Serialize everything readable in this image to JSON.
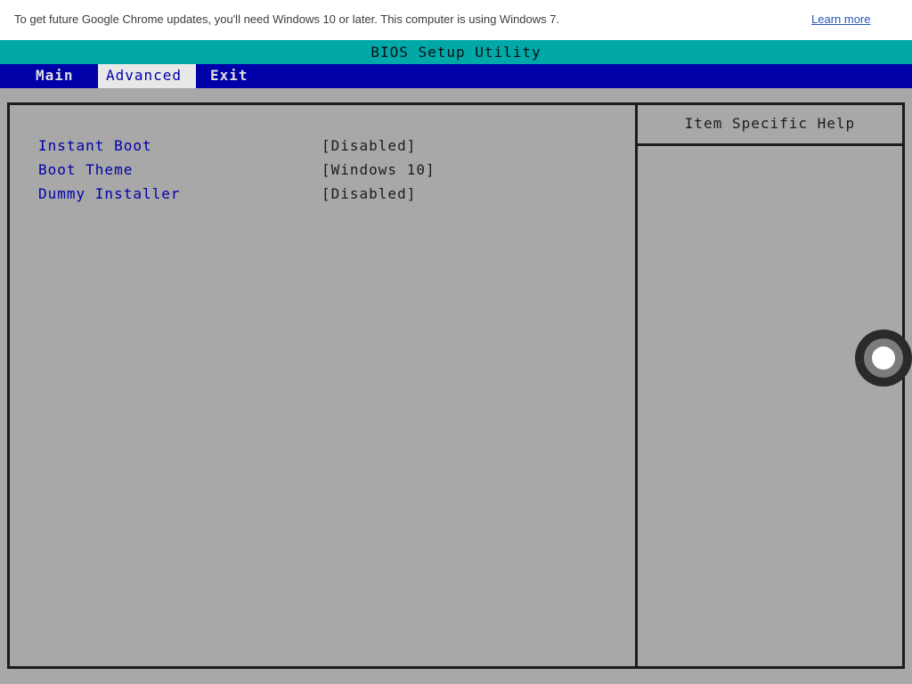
{
  "infobar": {
    "message": "To get future Google Chrome updates, you'll need Windows 10 or later. This computer is using Windows 7.",
    "learn_more": "Learn more"
  },
  "bios": {
    "title": "BIOS Setup Utility",
    "menu": [
      {
        "label": "Main",
        "active": false
      },
      {
        "label": "Advanced",
        "active": true
      },
      {
        "label": "Exit",
        "active": false
      }
    ],
    "settings": [
      {
        "label": "Instant Boot",
        "value": "[Disabled]"
      },
      {
        "label": "Boot Theme",
        "value": "[Windows 10]"
      },
      {
        "label": "Dummy Installer",
        "value": "[Disabled]"
      }
    ],
    "help_title": "Item Specific Help"
  },
  "colors": {
    "title_bar": "#00a8a8",
    "menu_bar": "#0000a8",
    "panel_bg": "#a8a8a8",
    "setting_label": "#0000a8"
  }
}
